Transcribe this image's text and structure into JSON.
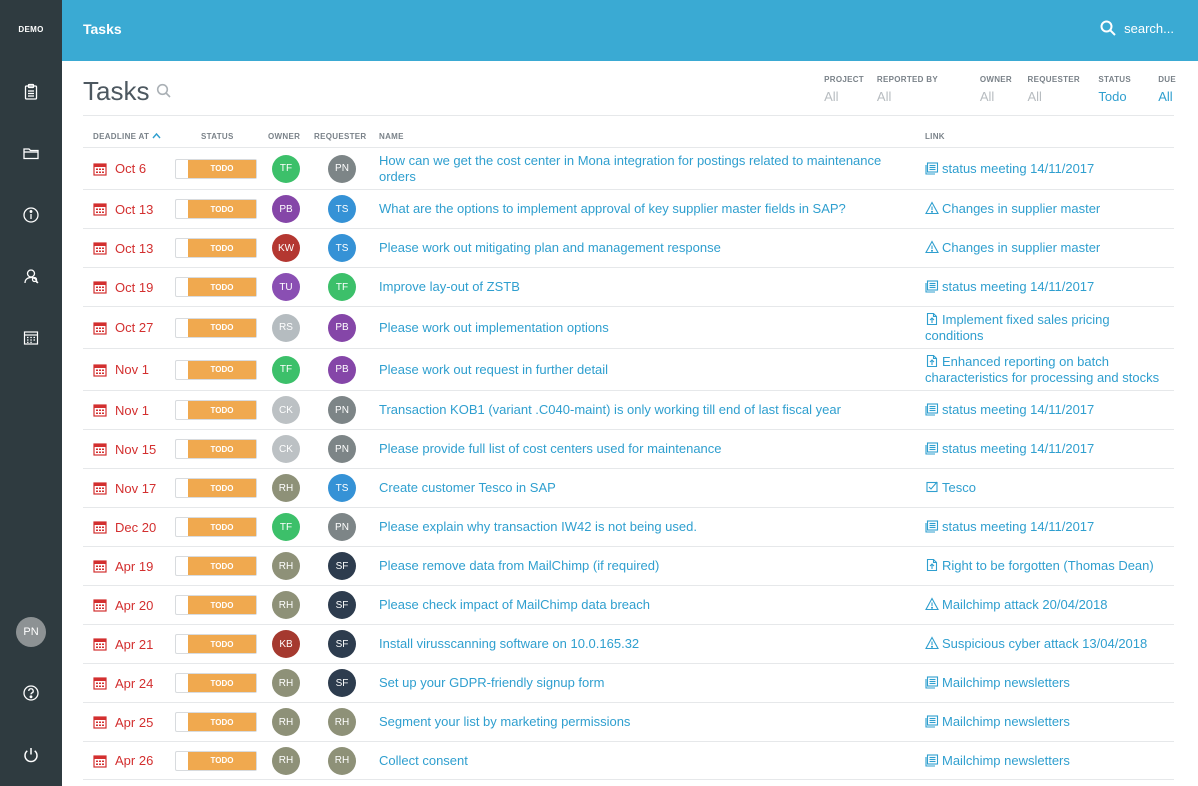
{
  "brand": "DEMO",
  "header": {
    "title": "Tasks",
    "search_placeholder": "search..."
  },
  "page": {
    "title": "Tasks"
  },
  "filters": [
    {
      "label": "PROJECT",
      "value": "All",
      "active": false
    },
    {
      "label": "REPORTED BY",
      "value": "All",
      "active": false
    },
    {
      "label": "OWNER",
      "value": "All",
      "active": false
    },
    {
      "label": "REQUESTER",
      "value": "All",
      "active": false
    },
    {
      "label": "STATUS",
      "value": "Todo",
      "active": true
    },
    {
      "label": "DUE",
      "value": "All",
      "active": true
    }
  ],
  "columns": {
    "deadline": "DEADLINE AT",
    "status": "STATUS",
    "owner": "OWNER",
    "requester": "REQUESTER",
    "name": "NAME",
    "link": "LINK"
  },
  "sidebar": {
    "items": [
      "clipboard-icon",
      "folder-icon",
      "info-icon",
      "user-search-icon",
      "calendar-grid-icon"
    ],
    "user_initials": "PN",
    "bottom": [
      "help-icon",
      "power-icon"
    ]
  },
  "people_colors": {
    "TF": "#3cc06a",
    "PN": "#7d8587",
    "PB": "#8546a8",
    "TS": "#3592d6",
    "KW": "#b43731",
    "TU": "#8a4fb3",
    "RS": "#b5bcc0",
    "CK": "#bcc1c4",
    "RH": "#8e9178",
    "SF": "#2d3c4e",
    "KB": "#a5392f"
  },
  "tasks": [
    {
      "deadline": "Oct 6",
      "status": "TODO",
      "owner": "TF",
      "requester": "PN",
      "name": "How can we get the cost center in Mona integration for postings related to maintenance orders",
      "link": "status meeting 14/11/2017",
      "link_icon": "meeting-icon"
    },
    {
      "deadline": "Oct 13",
      "status": "TODO",
      "owner": "PB",
      "requester": "TS",
      "name": "What are the options to implement approval of key supplier master fields in SAP?",
      "link": "Changes in supplier master",
      "link_icon": "warning-icon"
    },
    {
      "deadline": "Oct 13",
      "status": "TODO",
      "owner": "KW",
      "requester": "TS",
      "name": "Please work out mitigating plan and management response",
      "link": "Changes in supplier master",
      "link_icon": "warning-icon"
    },
    {
      "deadline": "Oct 19",
      "status": "TODO",
      "owner": "TU",
      "requester": "TF",
      "name": "Improve lay-out of ZSTB",
      "link": "status meeting 14/11/2017",
      "link_icon": "meeting-icon"
    },
    {
      "deadline": "Oct 27",
      "status": "TODO",
      "owner": "RS",
      "requester": "PB",
      "name": "Please work out implementation options",
      "link": "Implement fixed sales pricing conditions",
      "link_icon": "upload-doc-icon"
    },
    {
      "deadline": "Nov 1",
      "status": "TODO",
      "owner": "TF",
      "requester": "PB",
      "name": "Please work out request in further detail",
      "link": "Enhanced reporting on batch characteristics for processing and stocks",
      "link_icon": "upload-doc-icon"
    },
    {
      "deadline": "Nov 1",
      "status": "TODO",
      "owner": "CK",
      "requester": "PN",
      "name": "Transaction KOB1 (variant .C040-maint) is only working till end of last fiscal year",
      "link": "status meeting 14/11/2017",
      "link_icon": "meeting-icon"
    },
    {
      "deadline": "Nov 15",
      "status": "TODO",
      "owner": "CK",
      "requester": "PN",
      "name": "Please provide full list of cost centers used for maintenance",
      "link": "status meeting 14/11/2017",
      "link_icon": "meeting-icon"
    },
    {
      "deadline": "Nov 17",
      "status": "TODO",
      "owner": "RH",
      "requester": "TS",
      "name": "Create customer Tesco in SAP",
      "link": "Tesco",
      "link_icon": "checklist-icon"
    },
    {
      "deadline": "Dec 20",
      "status": "TODO",
      "owner": "TF",
      "requester": "PN",
      "name": "Please explain why transaction IW42 is not being used.",
      "link": "status meeting 14/11/2017",
      "link_icon": "meeting-icon"
    },
    {
      "deadline": "Apr 19",
      "status": "TODO",
      "owner": "RH",
      "requester": "SF",
      "name": "Please remove data from MailChimp (if required)",
      "link": "Right to be forgotten (Thomas Dean)",
      "link_icon": "upload-doc-icon"
    },
    {
      "deadline": "Apr 20",
      "status": "TODO",
      "owner": "RH",
      "requester": "SF",
      "name": "Please check impact of MailChimp data breach",
      "link": "Mailchimp attack 20/04/2018",
      "link_icon": "warning-icon"
    },
    {
      "deadline": "Apr 21",
      "status": "TODO",
      "owner": "KB",
      "requester": "SF",
      "name": "Install virusscanning software on 10.0.165.32",
      "link": "Suspicious cyber attack 13/04/2018",
      "link_icon": "warning-icon"
    },
    {
      "deadline": "Apr 24",
      "status": "TODO",
      "owner": "RH",
      "requester": "SF",
      "name": "Set up your GDPR-friendly signup form",
      "link": "Mailchimp newsletters",
      "link_icon": "meeting-icon"
    },
    {
      "deadline": "Apr 25",
      "status": "TODO",
      "owner": "RH",
      "requester": "RH",
      "name": "Segment your list by marketing permissions",
      "link": "Mailchimp newsletters",
      "link_icon": "meeting-icon"
    },
    {
      "deadline": "Apr 26",
      "status": "TODO",
      "owner": "RH",
      "requester": "RH",
      "name": "Collect consent",
      "link": "Mailchimp newsletters",
      "link_icon": "meeting-icon"
    }
  ]
}
